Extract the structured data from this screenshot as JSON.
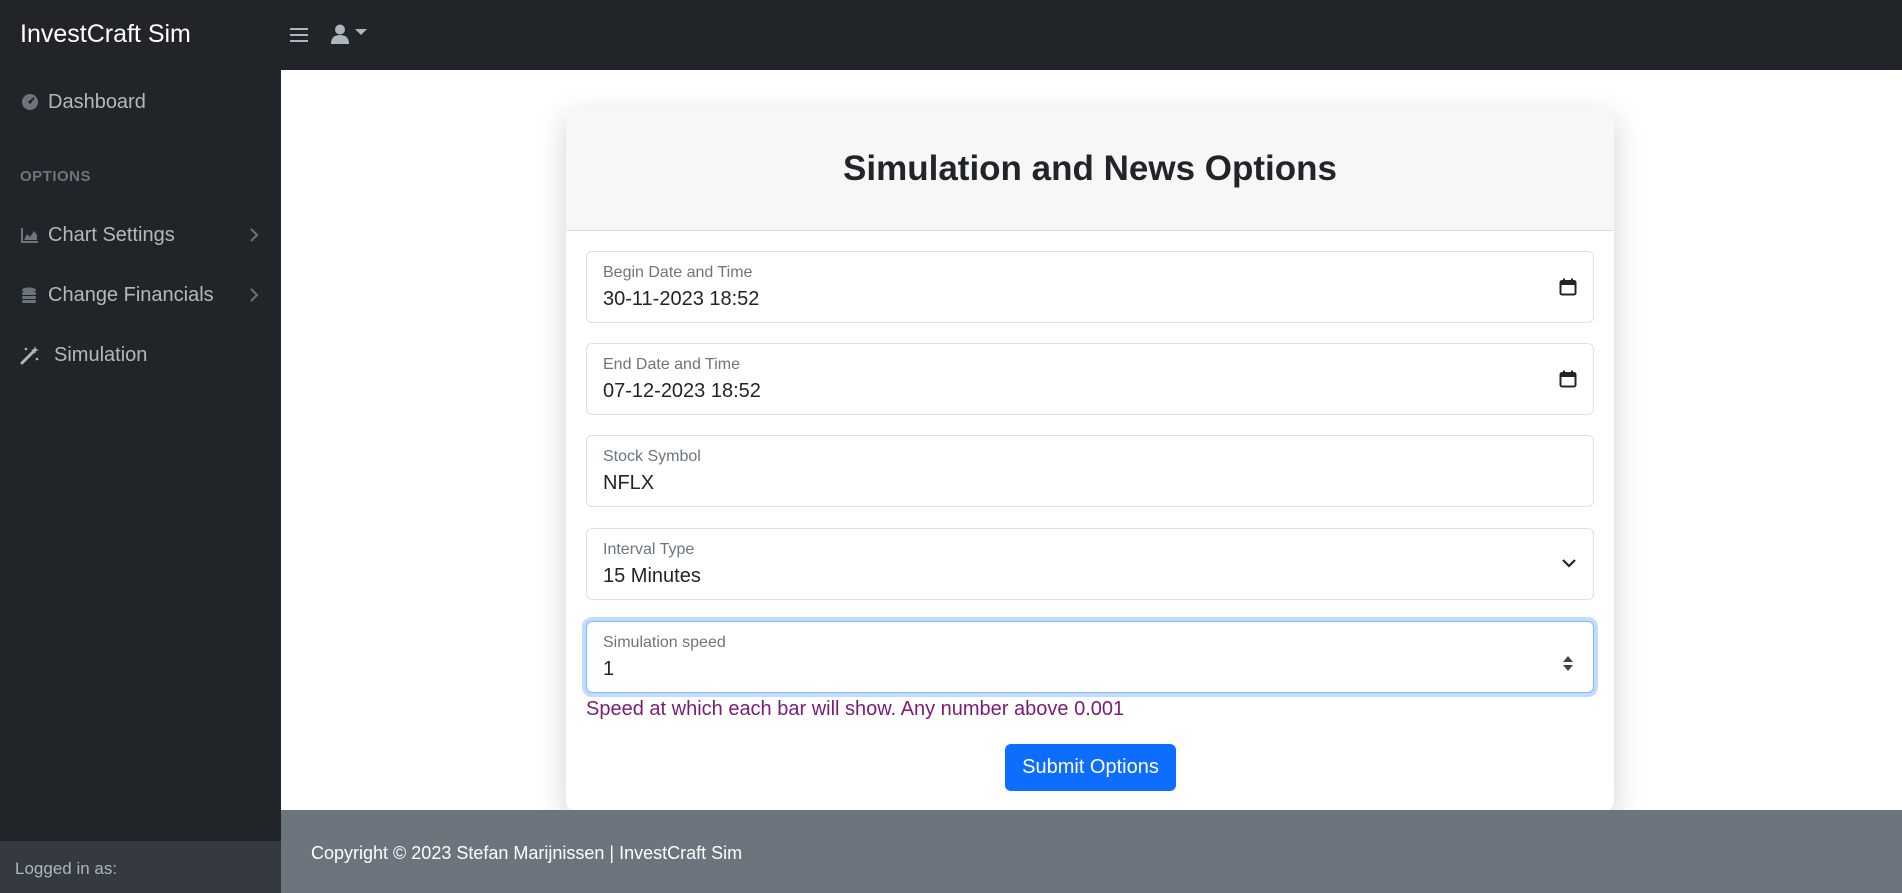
{
  "app": {
    "brand": "InvestCraft Sim"
  },
  "topbar": {
    "toggle_icon": "hamburger-icon",
    "user_icon": "user-icon"
  },
  "sidebar": {
    "items": [
      {
        "label": "Dashboard",
        "icon": "dashboard-gauge-icon"
      },
      {
        "label": "Chart Settings",
        "icon": "area-chart-icon",
        "has_submenu": true
      },
      {
        "label": "Change Financials",
        "icon": "coins-icon",
        "has_submenu": true
      },
      {
        "label": "Simulation",
        "icon": "magic-wand-icon"
      }
    ],
    "section_heading": "OPTIONS",
    "footer_text": "Logged in as:"
  },
  "card": {
    "title": "Simulation and News Options",
    "fields": [
      {
        "label": "Begin Date and Time",
        "value": "30-11-2023 18:52",
        "icon": "calendar-icon"
      },
      {
        "label": "End Date and Time",
        "value": "07-12-2023 18:52",
        "icon": "calendar-icon"
      },
      {
        "label": "Stock Symbol",
        "value": "NFLX"
      },
      {
        "label": "Interval Type",
        "value": "15 Minutes",
        "icon": "chevron-down-icon"
      },
      {
        "label": "Simulation speed",
        "value": "1",
        "icon": "spinner-icon"
      }
    ],
    "help_text": "Speed at which each bar will show. Any number above 0.001",
    "submit_label": "Submit Options"
  },
  "footer": {
    "text": "Copyright © 2023 Stefan Marijnissen | InvestCraft Sim"
  },
  "colors": {
    "dark_bg": "#212529",
    "primary": "#0d6efd",
    "footer_bg": "#6c757d",
    "help_text": "#7a1b7a",
    "focus_ring": "#86b7fe"
  }
}
